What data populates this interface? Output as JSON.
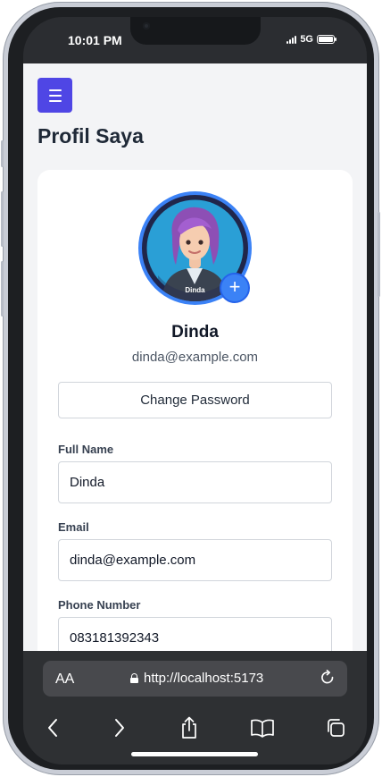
{
  "status_bar": {
    "time": "10:01 PM",
    "network": "5G"
  },
  "app": {
    "menu_icon": "hamburger-menu-icon",
    "page_title": "Profil Saya",
    "profile": {
      "avatar_caption": "Dinda",
      "name": "Dinda",
      "email": "dinda@example.com"
    },
    "change_password_label": "Change Password",
    "fields": {
      "full_name": {
        "label": "Full Name",
        "value": "Dinda"
      },
      "email": {
        "label": "Email",
        "value": "dinda@example.com"
      },
      "phone": {
        "label": "Phone Number",
        "value": "083181392343"
      }
    },
    "accent_color": "#4f46e5",
    "avatar_ring_color": "#3b82f6"
  },
  "browser": {
    "text_size_label": "AA",
    "url": "http://localhost:5173",
    "toolbar_icons": [
      "back-icon",
      "forward-icon",
      "share-icon",
      "bookmarks-icon",
      "tabs-icon"
    ]
  }
}
